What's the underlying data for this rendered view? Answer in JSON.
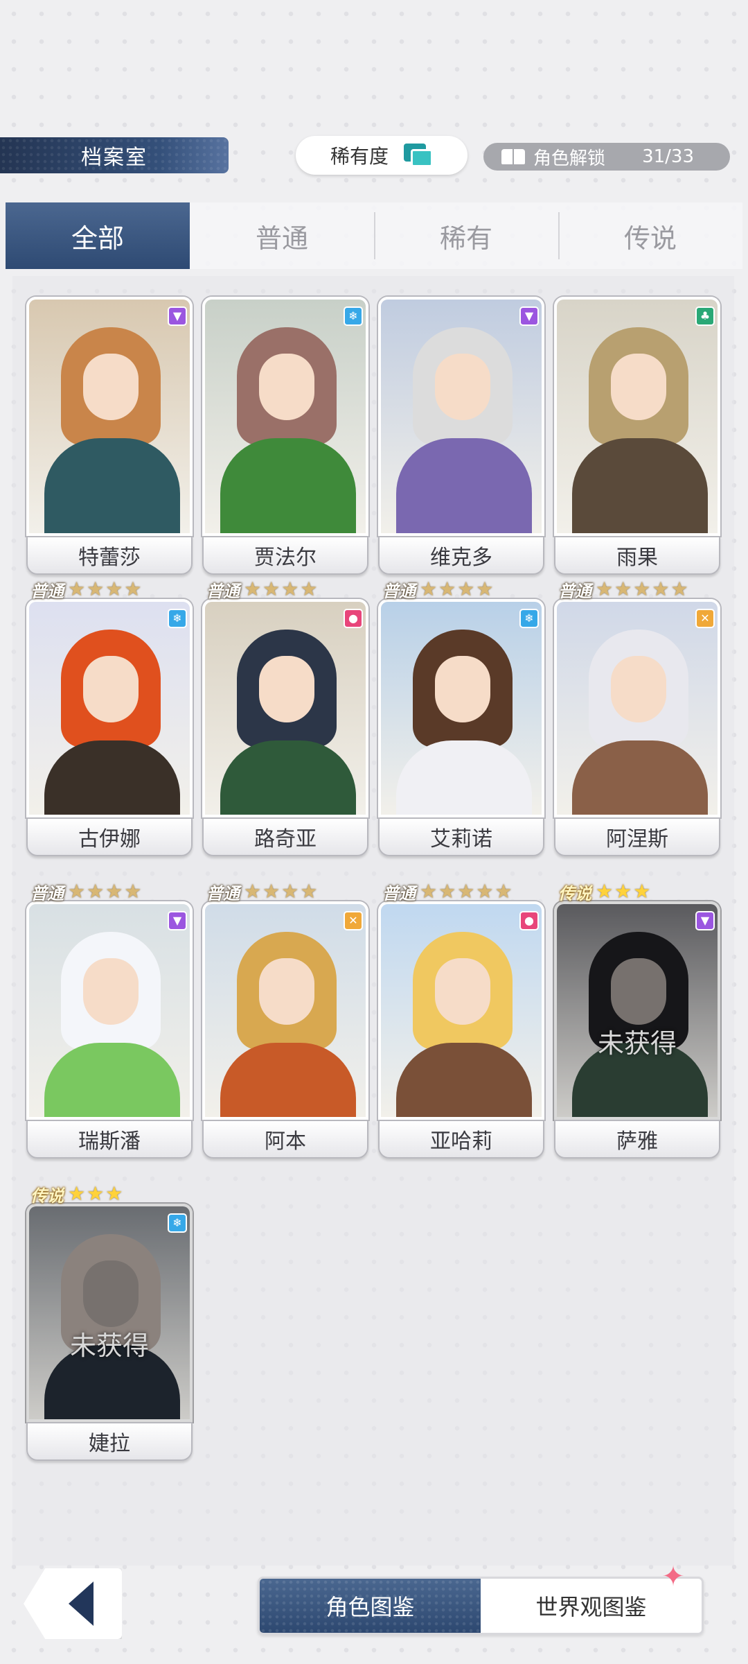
{
  "header": {
    "title": "档案室",
    "rarity_sort_label": "稀有度",
    "unlock_label": "角色解锁",
    "unlock_count": "31/33"
  },
  "tabs": [
    {
      "label": "全部",
      "active": true
    },
    {
      "label": "普通",
      "active": false
    },
    {
      "label": "稀有",
      "active": false
    },
    {
      "label": "传说",
      "active": false
    }
  ],
  "locked_text": "未获得",
  "characters": [
    {
      "name": "特蕾莎",
      "rarity": "",
      "stars": 0,
      "element": "purple",
      "hair": "#c9854a",
      "body": "#2f5a62",
      "bg": "#d8c8b0"
    },
    {
      "name": "贾法尔",
      "rarity": "",
      "stars": 0,
      "element": "blue",
      "hair": "#9a7068",
      "body": "#3f8a3a",
      "bg": "#c8d0c8"
    },
    {
      "name": "维克多",
      "rarity": "",
      "stars": 0,
      "element": "purple",
      "hair": "#dcdcdc",
      "body": "#7a68b0",
      "bg": "#c0cce0"
    },
    {
      "name": "雨果",
      "rarity": "",
      "stars": 0,
      "element": "green",
      "hair": "#b8a070",
      "body": "#5a4a3a",
      "bg": "#d8d4c8"
    },
    {
      "name": "古伊娜",
      "rarity": "普通",
      "stars": 4,
      "element": "blue",
      "hair": "#e0501e",
      "body": "#3a3028",
      "bg": "#dde0f0"
    },
    {
      "name": "路奇亚",
      "rarity": "普通",
      "stars": 4,
      "element": "pink",
      "hair": "#2c3648",
      "body": "#2f5a3a",
      "bg": "#d8d0c0"
    },
    {
      "name": "艾莉诺",
      "rarity": "普通",
      "stars": 4,
      "element": "blue",
      "hair": "#5a3a28",
      "body": "#f0f0f4",
      "bg": "#b8d0e8"
    },
    {
      "name": "阿涅斯",
      "rarity": "普通",
      "stars": 5,
      "element": "orange",
      "hair": "#e8e8ee",
      "body": "#8a6048",
      "bg": "#d0d8e8"
    },
    {
      "name": "瑞斯潘",
      "rarity": "普通",
      "stars": 4,
      "element": "purple",
      "hair": "#f4f6fa",
      "body": "#7ac860",
      "bg": "#d8e0e4"
    },
    {
      "name": "阿本",
      "rarity": "普通",
      "stars": 4,
      "element": "orange",
      "hair": "#d8a850",
      "body": "#c85a28",
      "bg": "#d0dce8"
    },
    {
      "name": "亚哈莉",
      "rarity": "普通",
      "stars": 5,
      "element": "pink",
      "hair": "#f0c860",
      "body": "#7a5038",
      "bg": "#c0d8f0"
    },
    {
      "name": "萨雅",
      "rarity": "传说",
      "stars": 3,
      "element": "purple",
      "hair": "#1a1a1e",
      "body": "#2a4a38",
      "bg": "#6a6a70",
      "locked": true
    },
    {
      "name": "婕拉",
      "rarity": "传说",
      "stars": 3,
      "element": "blue",
      "hair": "#a89890",
      "body": "#1e2a38",
      "bg": "#7a8088",
      "locked": true
    }
  ],
  "bottom_nav": {
    "characters_label": "角色图鉴",
    "world_label": "世界观图鉴"
  },
  "colors": {
    "accent": "#34507a",
    "element_purple": "#9b56e0",
    "element_blue": "#36a8e8",
    "element_green": "#2aa876",
    "element_pink": "#e8457a",
    "element_orange": "#f0a838"
  }
}
